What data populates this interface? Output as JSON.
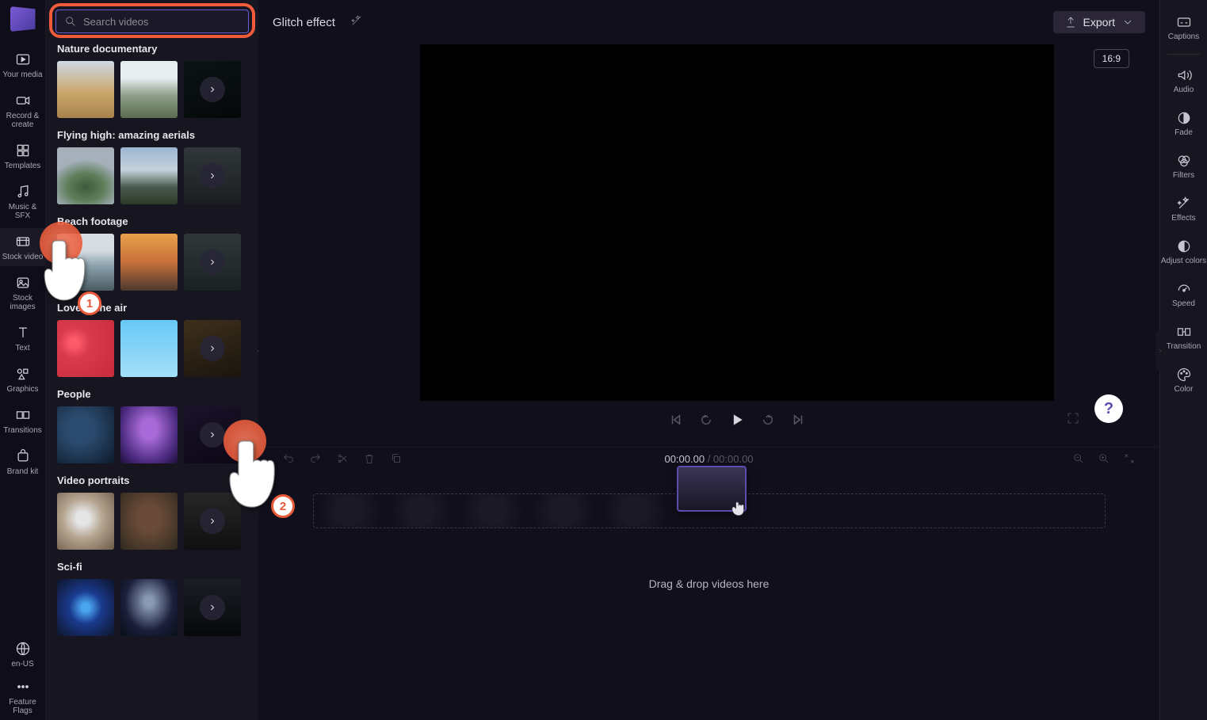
{
  "leftRail": {
    "items": [
      {
        "label": "Your media",
        "name": "your-media"
      },
      {
        "label": "Record & create",
        "name": "record-create"
      },
      {
        "label": "Templates",
        "name": "templates"
      },
      {
        "label": "Music & SFX",
        "name": "music-sfx"
      },
      {
        "label": "Stock video",
        "name": "stock-video",
        "active": true
      },
      {
        "label": "Stock images",
        "name": "stock-images"
      },
      {
        "label": "Text",
        "name": "text"
      },
      {
        "label": "Graphics",
        "name": "graphics"
      },
      {
        "label": "Transitions",
        "name": "transitions"
      },
      {
        "label": "Brand kit",
        "name": "brand-kit"
      }
    ],
    "footer": [
      {
        "label": "en-US",
        "name": "language"
      },
      {
        "label": "Feature Flags",
        "name": "feature-flags"
      }
    ]
  },
  "stockPanel": {
    "searchPlaceholder": "Search videos",
    "categories": [
      {
        "title": "Nature documentary"
      },
      {
        "title": "Flying high: amazing aerials"
      },
      {
        "title": "Beach footage"
      },
      {
        "title": "Love in the air"
      },
      {
        "title": "People"
      },
      {
        "title": "Video portraits"
      },
      {
        "title": "Sci-fi"
      }
    ]
  },
  "header": {
    "title": "Glitch effect",
    "exportLabel": "Export",
    "aspect": "16:9"
  },
  "playback": {
    "currentTime": "00:00.00",
    "totalTime": "00:00.00"
  },
  "timeline": {
    "dropHint": "Drag & drop videos here"
  },
  "rightRail": {
    "items": [
      {
        "label": "Captions",
        "name": "captions"
      },
      {
        "label": "Audio",
        "name": "audio"
      },
      {
        "label": "Fade",
        "name": "fade"
      },
      {
        "label": "Filters",
        "name": "filters"
      },
      {
        "label": "Effects",
        "name": "effects"
      },
      {
        "label": "Adjust colors",
        "name": "adjust-colors"
      },
      {
        "label": "Speed",
        "name": "speed"
      },
      {
        "label": "Transition",
        "name": "transition"
      },
      {
        "label": "Color",
        "name": "color"
      }
    ]
  },
  "tutorial": {
    "step1": "1",
    "step2": "2"
  },
  "help": "?"
}
